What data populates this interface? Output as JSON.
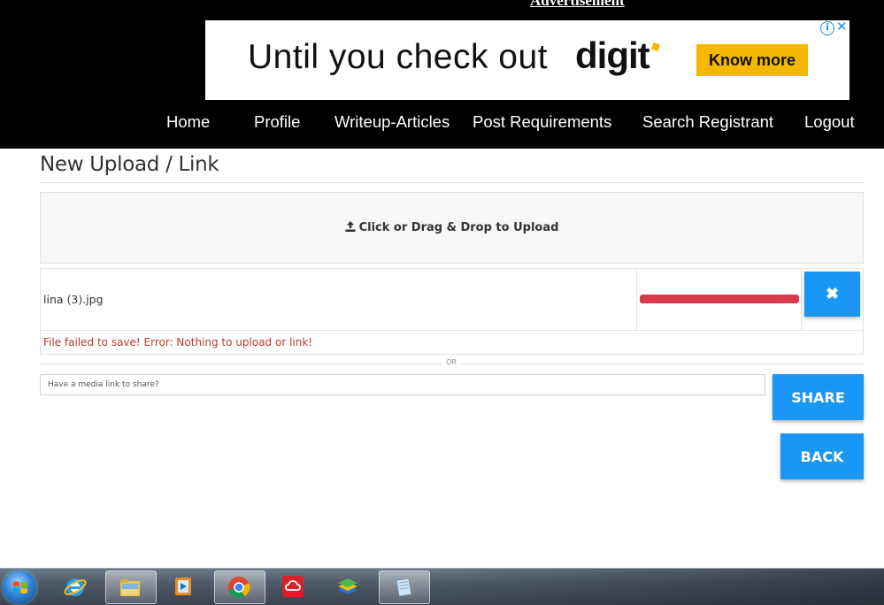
{
  "ad": {
    "label": "Advertisement",
    "headline": "Until you check out",
    "brand": "digit",
    "cta": "Know more",
    "info_glyph": "i",
    "close_glyph": "✕"
  },
  "nav": {
    "items": [
      "Home",
      "Profile",
      "Writeup-Articles",
      "Post Requirements",
      "Search Registrant",
      "Logout"
    ]
  },
  "page": {
    "title": "New Upload / Link"
  },
  "upload": {
    "dropzone_label": "Click or Drag & Drop to Upload",
    "file_name": "lina (3).jpg",
    "progress": 1.0,
    "progress_color": "#d9394c",
    "remove_glyph": "✖",
    "error": "File failed to save! Error: Nothing to upload or link!"
  },
  "divider": {
    "or": "OR"
  },
  "link": {
    "placeholder": "Have a media link to share?",
    "share_label": "SHARE",
    "back_label": "BACK"
  },
  "colors": {
    "accent": "#1a97f5",
    "error": "#c0392b",
    "ad_yellow": "#f5b800"
  },
  "taskbar": {
    "icons": [
      "start-orb-icon",
      "internet-explorer-icon",
      "file-explorer-icon",
      "media-player-icon",
      "chrome-icon",
      "adobe-creative-cloud-icon",
      "bluestacks-icon",
      "notepad-icon"
    ]
  }
}
